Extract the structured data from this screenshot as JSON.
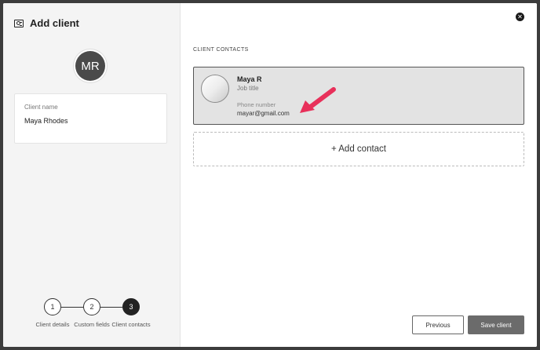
{
  "modal": {
    "title": "Add client",
    "title_icon": "contact-card-icon",
    "close_icon": "close-icon",
    "close_glyph": "✕"
  },
  "client": {
    "avatar_initials": "MR",
    "name_label": "Client name",
    "name_value": "Maya Rhodes"
  },
  "stepper": {
    "current_step": 3,
    "steps": [
      {
        "number": "1",
        "label": "Client details"
      },
      {
        "number": "2",
        "label": "Custom fields"
      },
      {
        "number": "3",
        "label": "Client contacts"
      }
    ]
  },
  "contacts": {
    "section_label": "CLIENT CONTACTS",
    "items": [
      {
        "name": "Maya R",
        "job_title": "Job title",
        "phone_placeholder": "Phone number",
        "email": "mayar@gmail.com"
      }
    ],
    "add_label": "+ Add contact"
  },
  "annotation": {
    "color": "#e8305a"
  },
  "footer": {
    "previous_label": "Previous",
    "save_label": "Save client"
  },
  "colors": {
    "dark": "#222222",
    "sidebar_bg": "#f4f4f4",
    "card_bg": "#e3e3e3",
    "save_bg": "#6b6b6b"
  }
}
